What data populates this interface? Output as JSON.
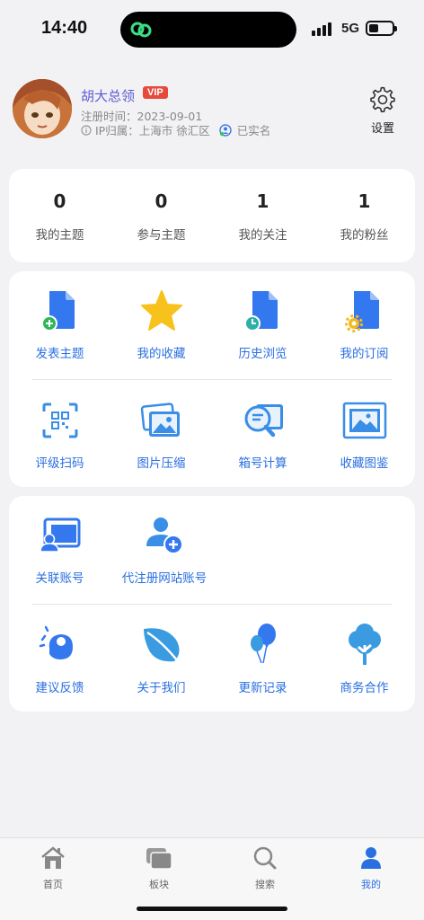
{
  "status": {
    "time": "14:40",
    "network": "5G"
  },
  "profile": {
    "name": "胡大总领",
    "vip": "VIP",
    "register": "注册时间：2023-09-01",
    "ip": "IP归属：上海市 徐汇区",
    "verified": "已实名",
    "settings_label": "设置"
  },
  "stats": [
    {
      "value": "0",
      "label": "我的主题"
    },
    {
      "value": "0",
      "label": "参与主题"
    },
    {
      "value": "1",
      "label": "我的关注"
    },
    {
      "value": "1",
      "label": "我的粉丝"
    }
  ],
  "grid1": {
    "row1": [
      {
        "label": "发表主题",
        "icon": "post-topic-icon"
      },
      {
        "label": "我的收藏",
        "icon": "star-icon"
      },
      {
        "label": "历史浏览",
        "icon": "history-icon"
      },
      {
        "label": "我的订阅",
        "icon": "subscription-icon"
      }
    ],
    "row2": [
      {
        "label": "评级扫码",
        "icon": "qr-scan-icon"
      },
      {
        "label": "图片压缩",
        "icon": "image-compress-icon"
      },
      {
        "label": "箱号计算",
        "icon": "search-calc-icon"
      },
      {
        "label": "收藏图鉴",
        "icon": "picture-frame-icon"
      }
    ]
  },
  "grid2": {
    "row1": [
      {
        "label": "关联账号",
        "icon": "link-account-icon"
      },
      {
        "label": "代注册网站账号",
        "icon": "add-user-icon"
      }
    ],
    "row2": [
      {
        "label": "建议反馈",
        "icon": "feedback-icon"
      },
      {
        "label": "关于我们",
        "icon": "leaf-icon"
      },
      {
        "label": "更新记录",
        "icon": "balloon-icon"
      },
      {
        "label": "商务合作",
        "icon": "tree-icon"
      }
    ]
  },
  "tabbar": [
    {
      "label": "首页",
      "icon": "home-icon"
    },
    {
      "label": "板块",
      "icon": "boards-icon"
    },
    {
      "label": "搜索",
      "icon": "search-icon"
    },
    {
      "label": "我的",
      "icon": "user-icon",
      "active": true
    }
  ],
  "colors": {
    "accent": "#2a6fe0",
    "vip": "#e64a3c",
    "name": "#5b5bd6"
  }
}
